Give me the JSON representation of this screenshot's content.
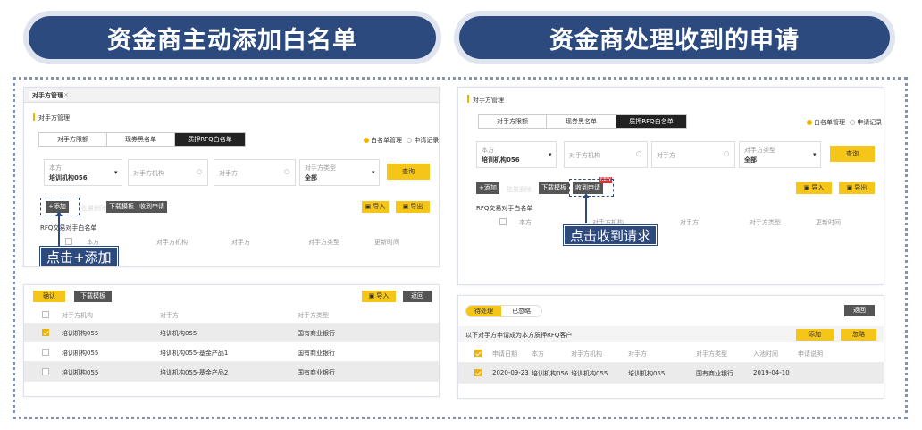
{
  "titles": {
    "left": "资金商主动添加白名单",
    "right": "资金商处理收到的申请"
  },
  "panel1": {
    "window_tab": "对手方管理",
    "section": "对手方管理",
    "tabs": [
      "对手方限额",
      "现券黑名单",
      "质押RFQ白名单"
    ],
    "radios": [
      "白名单管理",
      "申请记录"
    ],
    "field_self_label": "本方",
    "field_self_value": "培训机构056",
    "field_org_placeholder": "对手方机构",
    "field_cp_placeholder": "对手方",
    "field_type_label": "对手方类型",
    "field_type_value": "全部",
    "query": "查询",
    "add": "+添加",
    "delete": "批量删除",
    "template": "下载模板",
    "received": "收到申请",
    "import": "导入",
    "export": "导出",
    "list_title": "RFQ交易对手白名单",
    "columns": [
      "本方",
      "对手方机构",
      "对手方",
      "对手方类型",
      "更新时间"
    ],
    "callout": "点击+添加"
  },
  "panel2": {
    "window_tab": "对手方管理",
    "tabs": [
      "对手方限额",
      "现券黑名单",
      "质押RFQ白名单"
    ],
    "radios": [
      "白名单管理",
      "申请记录"
    ],
    "field_self_label": "本方",
    "field_self_value": "培训机构056",
    "field_org_placeholder": "对手方机构",
    "field_cp_placeholder": "对手方",
    "field_type_label": "对手方类型",
    "field_type_value": "全部",
    "query": "查询",
    "add": "+添加",
    "delete": "批量删除",
    "template": "下载模板",
    "received": "收到申请",
    "new_badge": "NEW",
    "import": "导入",
    "export": "导出",
    "list_title": "RFQ交易对手白名单",
    "columns": [
      "本方",
      "对手方机构",
      "对手方",
      "对手方类型",
      "更新时间"
    ],
    "callout": "点击收到请求"
  },
  "panel3": {
    "confirm": "确认",
    "template": "下载模板",
    "import": "导入",
    "back": "返回",
    "columns": [
      "对手方机构",
      "对手方",
      "对手方类型"
    ],
    "rows": [
      {
        "org": "培训机构055",
        "cp": "培训机构055",
        "type": "国有商业银行",
        "checked": true
      },
      {
        "org": "培训机构055",
        "cp": "培训机构055-基金产品1",
        "type": "国有商业银行",
        "checked": false
      },
      {
        "org": "培训机构055",
        "cp": "培训机构055-基金产品2",
        "type": "国有商业银行",
        "checked": false
      }
    ]
  },
  "panel4": {
    "tabs": [
      "待处理",
      "已忽略"
    ],
    "back": "返回",
    "notice": "以下对手方申请成为本方质押RFQ客户",
    "add": "添加",
    "ignore": "忽略",
    "columns": [
      "申请日期",
      "本方",
      "对手方机构",
      "对手方",
      "对手方类型",
      "入池时间",
      "申请说明"
    ],
    "row": {
      "date": "2020-09-23",
      "self": "培训机构056",
      "org": "培训机构055",
      "cp": "培训机构055",
      "type": "国有商业银行",
      "pool": "2019-04-10"
    }
  }
}
